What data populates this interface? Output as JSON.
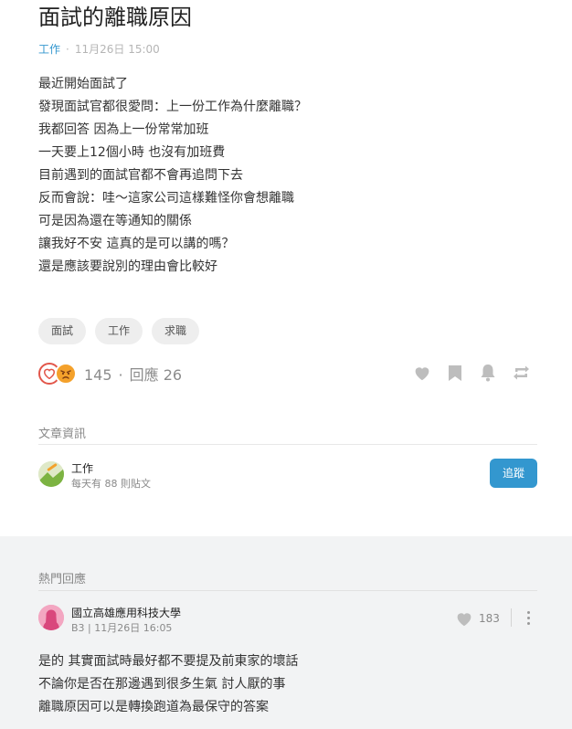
{
  "post": {
    "title": "面試的離職原因",
    "forum": "工作",
    "time": "11月26日 15:00",
    "body_lines": [
      "最近開始面試了",
      "發現面試官都很愛問：上一份工作為什麼離職？",
      "我都回答 因為上一份常常加班",
      "一天要上12個小時 也沒有加班費",
      "目前遇到的面試官都不會再追問下去",
      "反而會說：哇～這家公司這樣難怪你會想離職",
      "可是因為還在等通知的關係",
      "讓我好不安 這真的是可以講的嗎？",
      "還是應該要說別的理由會比較好"
    ],
    "tags": [
      "面試",
      "工作",
      "求職"
    ],
    "reaction_count": "145",
    "reply_label": "回應 26",
    "icons": {
      "reactions": [
        "heart-reaction-icon",
        "angry-reaction-icon"
      ],
      "actions": [
        "heart-icon",
        "bookmark-icon",
        "bell-icon",
        "share-icon"
      ]
    }
  },
  "article_info": {
    "label": "文章資訊",
    "forum_name": "工作",
    "forum_sub": "每天有 88 則貼文",
    "follow_label": "追蹤"
  },
  "hot_replies": {
    "label": "熱門回應",
    "comment": {
      "school": "國立高雄應用科技大學",
      "floor_time": "B3 | 11月26日 16:05",
      "likes": "183",
      "lines": [
        "是的 其實面試時最好都不要提及前東家的壞話",
        "不論你是否在那邊遇到很多生氣 討人厭的事",
        "離職原因可以是轉換跑道為最保守的答案"
      ]
    }
  },
  "colors": {
    "accent": "#3397cf",
    "heart_red": "#e2564a",
    "angry_orange": "#f4a12b",
    "icon_gray": "#bdbdbd",
    "hot_bg": "#f2f3f4"
  }
}
